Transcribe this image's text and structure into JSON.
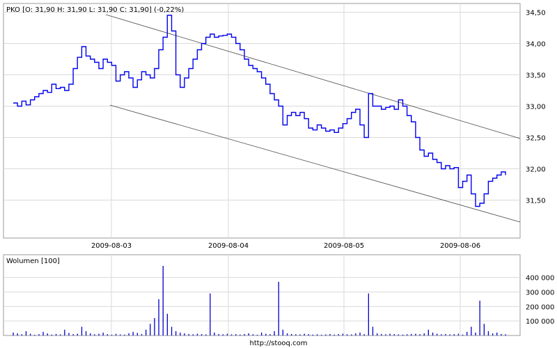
{
  "header": {
    "quote_line": "PKO [O: 31,90  H: 31,90  L: 31,90  C: 31,90] (-0,22%)"
  },
  "volume_panel": {
    "title": "Wolumen [100]"
  },
  "footer": {
    "source": "http://stooq.com"
  },
  "colors": {
    "price_line": "#0000ee",
    "volume_bars": "#0000cc",
    "grid": "#d9d9d9",
    "channel": "#444444"
  },
  "chart_data": [
    {
      "type": "line",
      "title": "PKO",
      "x_labels": [
        "2009-08-03",
        "2009-08-04",
        "2009-08-05",
        "2009-08-06"
      ],
      "y_ticks": [
        "31,50",
        "32,00",
        "32,50",
        "33,00",
        "33,50",
        "34,00",
        "34,50"
      ],
      "ylim": [
        31.0,
        34.6
      ],
      "grid": true,
      "series": [
        {
          "values": [
            33.05,
            33.0,
            33.08,
            33.02,
            33.1,
            33.15,
            33.2,
            33.25,
            33.22,
            33.35,
            33.28,
            33.3,
            33.25,
            33.35,
            33.6,
            33.78,
            33.95,
            33.8,
            33.75,
            33.7,
            33.6,
            33.75,
            33.7,
            33.65,
            33.4,
            33.5,
            33.55,
            33.45,
            33.3,
            33.42,
            33.55,
            33.5,
            33.45,
            33.6,
            33.9,
            34.1,
            34.45,
            34.2,
            33.5,
            33.3,
            33.45,
            33.6,
            33.75,
            33.9,
            34.0,
            34.1,
            34.15,
            34.1,
            34.12,
            34.13,
            34.15,
            34.1,
            34.0,
            33.9,
            33.75,
            33.65,
            33.6,
            33.55,
            33.45,
            33.35,
            33.2,
            33.1,
            33.0,
            32.7,
            32.85,
            32.9,
            32.85,
            32.9,
            32.8,
            32.65,
            32.62,
            32.7,
            32.65,
            32.6,
            32.62,
            32.58,
            32.65,
            32.72,
            32.8,
            32.9,
            32.95,
            32.7,
            32.5,
            33.2,
            33.0,
            33.0,
            32.95,
            32.98,
            33.0,
            32.95,
            33.1,
            33.0,
            32.85,
            32.75,
            32.5,
            32.3,
            32.2,
            32.25,
            32.15,
            32.1,
            32.0,
            32.05,
            32.0,
            32.02,
            31.7,
            31.8,
            31.9,
            31.6,
            31.4,
            31.45,
            31.6,
            31.8,
            31.85,
            31.9,
            31.95,
            31.9
          ]
        }
      ]
    },
    {
      "type": "bar",
      "title": "Wolumen [100]",
      "x_labels": [
        "2009-08-03",
        "2009-08-04",
        "2009-08-05",
        "2009-08-06"
      ],
      "y_ticks": [
        "100 000",
        "200 000",
        "300 000",
        "400 000"
      ],
      "ylim": [
        0,
        480000
      ],
      "grid": true,
      "series": [
        {
          "values": [
            20000,
            15000,
            8000,
            30000,
            12000,
            5000,
            9000,
            25000,
            14000,
            6000,
            10000,
            7000,
            40000,
            18000,
            9000,
            12000,
            60000,
            30000,
            15000,
            8000,
            12000,
            20000,
            9000,
            5000,
            11000,
            7000,
            6000,
            15000,
            25000,
            18000,
            10000,
            40000,
            80000,
            120000,
            250000,
            480000,
            150000,
            60000,
            30000,
            20000,
            15000,
            10000,
            8000,
            12000,
            9000,
            7000,
            290000,
            20000,
            10000,
            8000,
            12000,
            7000,
            9000,
            6000,
            10000,
            15000,
            8000,
            5000,
            20000,
            12000,
            9000,
            30000,
            370000,
            40000,
            15000,
            10000,
            8000,
            7000,
            12000,
            9000,
            6000,
            8000,
            5000,
            7000,
            10000,
            6000,
            9000,
            12000,
            8000,
            7000,
            15000,
            20000,
            9000,
            290000,
            60000,
            15000,
            10000,
            8000,
            12000,
            9000,
            7000,
            6000,
            8000,
            10000,
            12000,
            9000,
            15000,
            40000,
            20000,
            12000,
            8000,
            10000,
            7000,
            9000,
            12000,
            6000,
            25000,
            60000,
            20000,
            240000,
            80000,
            30000,
            15000,
            20000,
            10000,
            8000
          ]
        }
      ]
    }
  ]
}
